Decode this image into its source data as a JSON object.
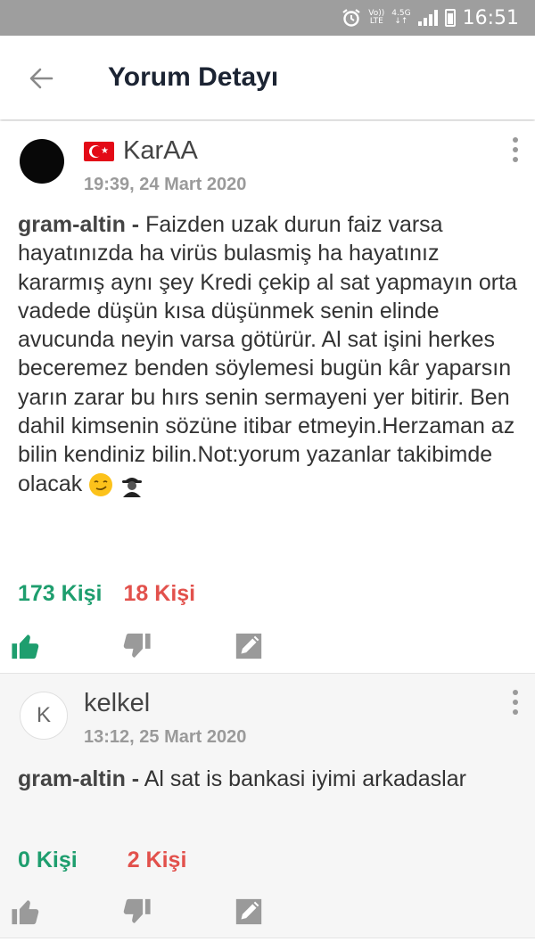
{
  "status_bar": {
    "time": "16:51",
    "volte_top": "Vo))",
    "volte_bottom": "LTE",
    "network_top": "4.5G",
    "network_bottom": "↓↑"
  },
  "app_bar": {
    "title": "Yorum Detayı",
    "back_icon": "arrow-left-icon"
  },
  "comments": [
    {
      "username": "KarAA",
      "flag": "turkey-flag-icon",
      "date": "19:39, 24 Mart 2020",
      "symbol": "gram-altin -",
      "text": "Faizden uzak durun faiz varsa hayatınızda ha virüs bulasmiş ha hayatınız kararmış aynı şey Kredi çekip al sat yapmayın orta vadede düşün kısa düşünmek senin elinde avucunda neyin varsa götürür. Al sat işini herkes beceremez benden söylemesi bugün kâr yaparsın yarın zarar bu hırs senin sermayeni yer bitirir. Ben dahil kimsenin sözüne itibar etmeyin.Herzaman az bilin kendiniz bilin.Not:yorum yazanlar takibimde olacak",
      "likes": "173 Kişi",
      "dislikes": "18 Kişi",
      "like_active": true
    },
    {
      "avatar_letter": "K",
      "username": "kelkel",
      "date": "13:12, 25 Mart 2020",
      "symbol": "gram-altin -",
      "text": "Al sat is bankasi iyimi arkadaslar",
      "likes": "0 Kişi",
      "dislikes": "2 Kişi",
      "like_active": false
    }
  ],
  "colors": {
    "status_bar": "#9e9e9e",
    "like": "#1e9e6e",
    "dislike": "#e2514c",
    "icon_inactive": "#9a9a9a",
    "title": "#1c2433"
  }
}
